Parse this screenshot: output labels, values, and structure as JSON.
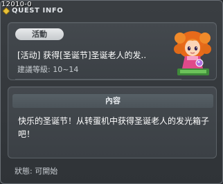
{
  "window": {
    "quest_id": "12010-0",
    "title": "QUEST INFO"
  },
  "quest": {
    "category_badge": "活動",
    "name": "[活动] 获得[圣诞节]圣诞老人的发..",
    "level_requirement": "建議等級: 10~14"
  },
  "content": {
    "header": "內容",
    "description": "快乐的圣诞节！从转蛋机中获得圣诞老人的发光箱子吧！"
  },
  "status": {
    "text": "狀態: 可開始"
  },
  "colors": {
    "title_accent": "#e8c23a",
    "panel_bg": "#41464b",
    "badge_bg": "#d9dcdf",
    "npc_hair": "#e86a1a",
    "npc_dress": "#e04a8a"
  },
  "icons": {
    "title": "quest-diamond-icon",
    "npc": "npc-portrait"
  }
}
